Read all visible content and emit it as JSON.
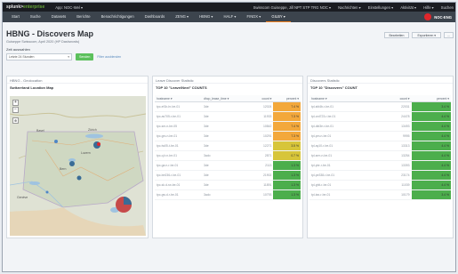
{
  "topbar": {
    "logo_prefix": "splunk>",
    "logo_suffix": "enterprise",
    "app_label": "App: NOC-Wel ▾",
    "items": [
      "Swisscom Guiseppe, Jill NPT STP TRG NOC ▾",
      "Nachrichten ▾",
      "Einstellungen ▾",
      "Aktivität ▾",
      "Hilfe ▾",
      "Suchen"
    ]
  },
  "navbar": {
    "items": [
      "Start",
      "Suche",
      "Datasets",
      "Berichte",
      "Benachrichtigungen",
      "Dashboards",
      "ZENG ▾",
      "HBNG ▾",
      "HALF ▾",
      "FINDX ▾",
      "GILBY ▾"
    ],
    "active_index": 10,
    "brand": "NOC-ENG"
  },
  "header": {
    "title": "HBNG - Discovers Map",
    "subtitle": "Guiseppe Swisscom, April 2020 (HP Dashwords)",
    "zone_label": "Zeit auswahlen",
    "select_value": "Letzte 24 Stunden",
    "submit_label": "Senden",
    "hide_filters": "Filter ausblenden",
    "buttons": [
      "Bearbeiten",
      "Exportieren ▾",
      "..."
    ]
  },
  "panels": {
    "map": {
      "head": "HBNG - Geolocation",
      "title": "Switzerland Location Map",
      "labels": [
        "Basel",
        "Zürich",
        "Bern",
        "Luzern",
        "Genève"
      ]
    },
    "leave": {
      "head": "Leave Discover Statistic",
      "title": "TOP 10 \"Leave/Next\" COUNTS",
      "columns": [
        "hostname ▾",
        "dhcp_lease_time ▾",
        "count ▾",
        "percent ▾"
      ]
    },
    "discovers": {
      "head": "Discovers Statistic",
      "title": "TOP 10 \"Discovers\" COUNT",
      "columns": [
        "hostname ▾",
        "count ▾",
        "percent ▾"
      ]
    }
  },
  "leave_rows": [
    [
      "tpc-ef1b-hr-be-01",
      "3de",
      "12024",
      "7.4 %"
    ],
    [
      "tpc-as705-r-be-01",
      "3de",
      "11933",
      "7.3 %"
    ],
    [
      "tpc-sm-n-be-05",
      "3de",
      "10842",
      "7.4 %"
    ],
    [
      "tpc-grs-n-be-01",
      "3de",
      "10291",
      "7.3 %"
    ],
    [
      "tpc-tw05-t-be-01",
      "3de",
      "12271",
      "3.5 %"
    ],
    [
      "tpc-q.b.n-be-01",
      "3ado",
      "2871",
      "0.7 %"
    ],
    [
      "tpc-ga.n-r-be-01",
      "3de",
      "2113",
      "1.3 %"
    ],
    [
      "tpc-bn036-r-be-01",
      "3de",
      "21902",
      "1.3 %"
    ],
    [
      "tpc-sk.d-rw-be-01",
      "3de",
      "11891",
      "1.3 %"
    ],
    [
      "tpc-gw.d-r-be-01",
      "3ado",
      "10793",
      "1.3 %"
    ]
  ],
  "leave_colors": [
    "#f3a83b",
    "#f3a83b",
    "#f3a83b",
    "#f3a83b",
    "#d7c53a",
    "#d7c53a",
    "#4cae4c",
    "#4cae4c",
    "#4cae4c",
    "#4cae4c"
  ],
  "disc_rows": [
    [
      "tpl-sfd4b-r-be-01",
      "22031",
      "3.4 %"
    ],
    [
      "tpl-ord723-r-be-01",
      "24478",
      "4.4 %"
    ],
    [
      "tpl-dkt3e-r-be-01",
      "13493",
      "4.4 %"
    ],
    [
      "tpl-pm-n-be-01",
      "9995",
      "4.4 %"
    ],
    [
      "tpl-ay10-r-be-01",
      "13313",
      "4.4 %"
    ],
    [
      "tpl-srm-n-be-01",
      "13254",
      "4.4 %"
    ],
    [
      "tpl-pbr-r-be-01",
      "13393",
      "4.4 %"
    ],
    [
      "tpl-pe338-r-be-01",
      "23174",
      "4.4 %"
    ],
    [
      "tpl-ghit-r-be-01",
      "11039",
      "4.4 %"
    ],
    [
      "tpl-tax-r-be-01",
      "10179",
      "3.4 %"
    ]
  ],
  "disc_colors": [
    "#4cae4c",
    "#4cae4c",
    "#4cae4c",
    "#4cae4c",
    "#4cae4c",
    "#4cae4c",
    "#4cae4c",
    "#4cae4c",
    "#4cae4c",
    "#4cae4c"
  ]
}
